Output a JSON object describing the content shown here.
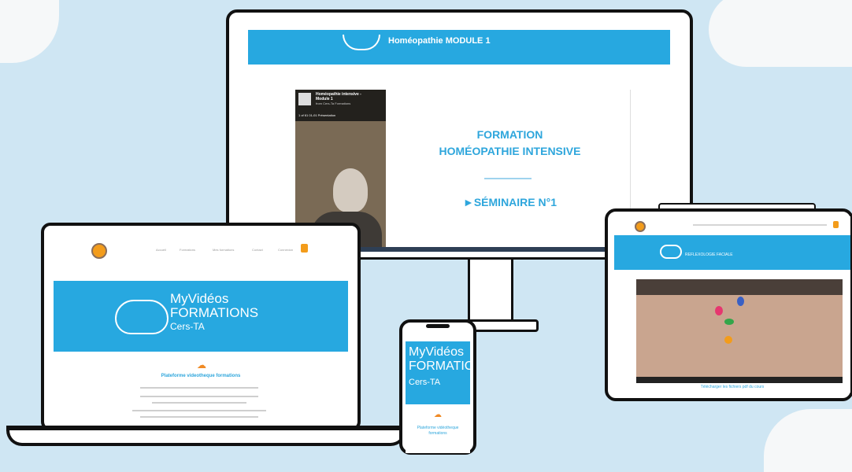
{
  "monitor": {
    "header_title": "Homéopathie MODULE 1",
    "video": {
      "title_line1": "Homéopathie intensive -",
      "title_line2": "Module 1",
      "subtitle": "from Cers-Ta Formations",
      "controls": "1 of 61   01-01 Présentation"
    },
    "slide_title_line1": "FORMATION",
    "slide_title_line2": "HOMÉOPATHIE INTENSIVE",
    "slide_section": "►SÉMINAIRE N°1"
  },
  "laptop": {
    "nav_items": [
      "Accueil",
      "Formations",
      "Mes formations",
      "Contact",
      "Connexion"
    ],
    "hero_line1": "MyVidéos",
    "hero_line2": "FORMATIONS",
    "hero_line3": "Cers-TA",
    "subheading": "Plateforme videotheque formations"
  },
  "phone": {
    "hero_line1": "MyVidéos",
    "hero_line2": "FORMATIC",
    "hero_line3": "Cers-TA",
    "subheading_line1": "Plateforme vidéotheque",
    "subheading_line2": "formations"
  },
  "tablet": {
    "header_title": "REFLEXOLOGIE FACIALE",
    "footer_link": "Télécharger les fichiers pdf du cours"
  },
  "colors": {
    "accent": "#27a8e0",
    "orange": "#f08a24",
    "background": "#cfe6f3"
  }
}
